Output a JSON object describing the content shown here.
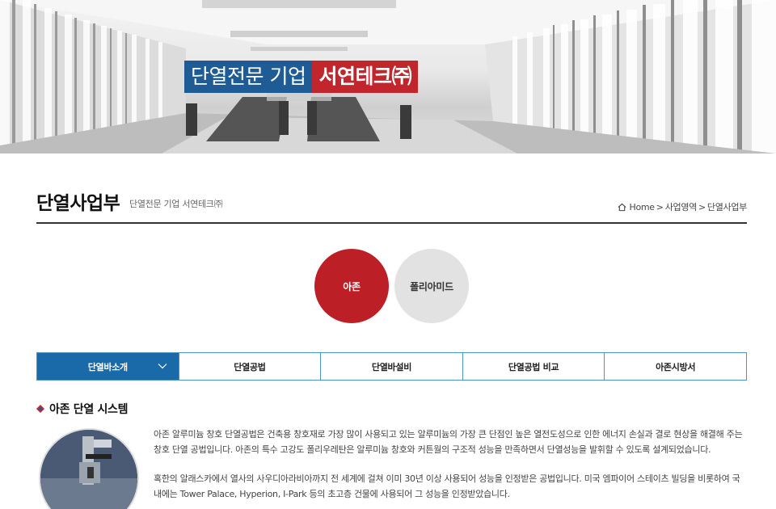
{
  "hero": {
    "title_main": "단열전문 기업",
    "title_company": "서연테크㈜"
  },
  "header": {
    "page_title": "단열사업부",
    "page_subtitle": "단열전문 기업 서연테크㈜",
    "breadcrumb": [
      "Home",
      "사업영역",
      "단열사업부"
    ],
    "breadcrumb_sep": ">"
  },
  "categories": [
    {
      "label": "아존",
      "active": true
    },
    {
      "label": "폴리아미드",
      "active": false
    }
  ],
  "tabs": [
    {
      "label": "단열바소개",
      "active": true
    },
    {
      "label": "단열공법",
      "active": false
    },
    {
      "label": "단열바설비",
      "active": false
    },
    {
      "label": "단열공법 비교",
      "active": false
    },
    {
      "label": "아존시방서",
      "active": false
    }
  ],
  "section": {
    "title": "아존 단열 시스템",
    "paragraphs": [
      "아존 알루미늄 창호 단열공법은 건축용 창호재로 가장 많이 사용되고 있는 알루미늄의 가장 큰 단점인 높은 열전도성으로 인한 에너지 손실과 결로 현상을 해결해 주는 창호 단열 공법입니다. 아존의 특수 고강도 폴리우레탄은 알루미늄 창호와 커튼월의 구조적 성능을 만족하면서 단열성능을 발휘할 수 있도록 설계되었습니다.",
      "혹한의 알래스카에서 열사의 사우디아라비아까지 전 세계에 걸쳐 이미 30년 이상 사용되어 성능을 인정받은 공법입니다. 미국 엠파이어 스테이츠 빌딩을 비롯하여 국내에는 Tower Palace, Hyperion, I-Park 등의 초고층 건물에 사용되어 그 성능을 인정받았습니다."
    ]
  },
  "colors": {
    "brand_blue": "#1f5c96",
    "brand_red": "#c0262c",
    "active_circle": "#bc1f25",
    "tab_active": "#1a6aaa",
    "tab_border": "#4b93c3"
  },
  "icons": {
    "breadcrumb_home": "home-icon",
    "tab_dropdown": "chevron-down-icon",
    "section_bullet": "diamond-bullet-icon"
  }
}
